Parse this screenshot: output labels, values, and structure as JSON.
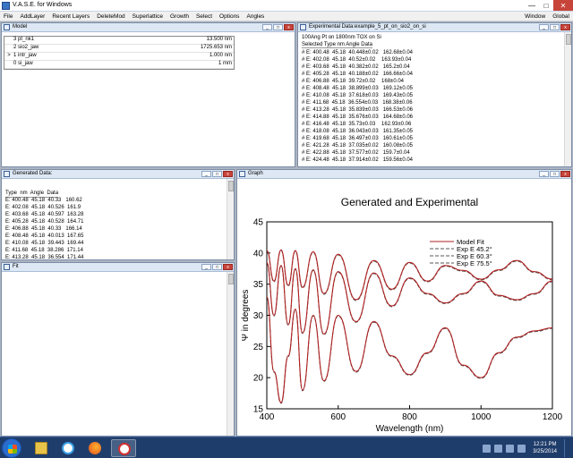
{
  "app": {
    "title": "V.A.S.E. for Windows"
  },
  "window_controls": {
    "minimize": "—",
    "maximize": "□",
    "close": "✕"
  },
  "menu": {
    "items": [
      "File",
      "AddLayer",
      "Recent Layers",
      "DeleteMod",
      "Superlattice",
      "Growth",
      "Select",
      "Options",
      "Angles"
    ],
    "right_items": [
      "Window",
      "Global"
    ]
  },
  "model_pane": {
    "title": "Model",
    "rows": [
      {
        "mark": "",
        "layer": "3 pt_nk1",
        "thickness": "13.500 nm"
      },
      {
        "mark": "",
        "layer": "2 sio2_jaw",
        "thickness": "1725.653 nm"
      },
      {
        "mark": ">",
        "layer": "1 intr_jaw",
        "thickness": "1.000 nm"
      },
      {
        "mark": "",
        "layer": "0 si_jaw",
        "thickness": "1 mm"
      }
    ]
  },
  "exp_pane": {
    "title": "Experimental Data:example_5_pt_on_sio2_on_si",
    "subtitle": "100Ang Pt on 1800nm TOX on Si",
    "header": "Selected Type  nm  Angle  Data",
    "rows": [
      "# E: 400.48  45.18  40.448±0.02   162.68±0.04",
      "# E: 402.08  45.18  40.52±0.02    163.93±0.04",
      "# E: 403.68  45.18  40.382±0.02   165.2±0.04",
      "# E: 405.28  45.18  40.188±0.02   166.66±0.04",
      "# E: 406.88  45.18  39.72±0.02    168±0.04",
      "# E: 408.48  45.18  38.899±0.03   169.12±0.05",
      "# E: 410.08  45.18  37.618±0.03   169.43±0.05",
      "# E: 411.68  45.18  36.554±0.03   168.38±0.06",
      "# E: 413.28  45.18  35.839±0.03   166.53±0.06",
      "# E: 414.88  45.18  35.676±0.03   164.68±0.06",
      "# E: 416.48  45.18  35.73±0.03    162.93±0.06",
      "# E: 418.08  45.18  36.043±0.03   161.35±0.05",
      "# E: 419.68  45.18  36.497±0.03   160.61±0.05",
      "# E: 421.28  45.18  37.035±0.02   160.08±0.05",
      "# E: 422.88  45.18  37.577±0.02   159.7±0.04",
      "# E: 424.48  45.18  37.914±0.02   159.56±0.04"
    ]
  },
  "gen_pane": {
    "title": "Generated Data:",
    "header": "Type  nm  Angle  Data",
    "rows": [
      "E: 400.48  45.18  40.33   160.62",
      "E: 402.08  45.18  40.526  161.9",
      "E: 403.68  45.18  40.597  163.28",
      "E: 405.28  45.18  40.528  164.71",
      "E: 406.88  45.18  40.33   166.14",
      "E: 408.48  45.18  40.013  167.65",
      "E: 410.08  45.18  39.443  169.44",
      "E: 411.68  45.18  38.286  171.14",
      "E: 413.28  45.18  36.554  171.44"
    ]
  },
  "fit_pane": {
    "title": "Fit"
  },
  "graph_pane": {
    "title": "Graph"
  },
  "chart_data": {
    "type": "line",
    "title": "Generated and Experimental",
    "xlabel": "Wavelength (nm)",
    "ylabel": "Ψ in degrees",
    "xlim": [
      400,
      1200
    ],
    "ylim": [
      15,
      45
    ],
    "xticks": [
      400,
      600,
      800,
      1000,
      1200
    ],
    "yticks": [
      15,
      20,
      25,
      30,
      35,
      40,
      45
    ],
    "grid": false,
    "legend_position": "top-right",
    "legend": [
      "Model Fit",
      "Exp E 45.2°",
      "Exp E 60.3°",
      "Exp E 75.5°"
    ],
    "series": [
      {
        "angle": 45.2,
        "x": [
          400,
          420,
          440,
          460,
          480,
          500,
          530,
          560,
          600,
          650,
          700,
          750,
          800,
          850,
          900,
          950,
          1000,
          1050,
          1100,
          1150,
          1200
        ],
        "y": [
          40.4,
          35.5,
          40.5,
          34.8,
          40.4,
          34.5,
          40.2,
          33.5,
          39.8,
          32.5,
          38.8,
          34.2,
          38.5,
          35.5,
          38.0,
          37.2,
          35.8,
          37.3,
          38.8,
          37.0,
          35.8
        ]
      },
      {
        "angle": 60.3,
        "x": [
          400,
          420,
          440,
          460,
          480,
          500,
          530,
          560,
          600,
          650,
          700,
          750,
          800,
          850,
          900,
          950,
          1000,
          1050,
          1100,
          1150,
          1200
        ],
        "y": [
          38.5,
          30.0,
          38.0,
          28.5,
          37.5,
          27.2,
          37.3,
          27.0,
          37.0,
          29.0,
          36.8,
          31.5,
          36.0,
          33.5,
          32.0,
          33.5,
          35.5,
          33.2,
          32.5,
          33.5,
          35.5
        ]
      },
      {
        "angle": 75.5,
        "x": [
          400,
          420,
          440,
          460,
          480,
          500,
          530,
          560,
          600,
          650,
          700,
          750,
          800,
          850,
          900,
          950,
          1000,
          1050,
          1100,
          1150,
          1200
        ],
        "y": [
          33.0,
          21.0,
          16.0,
          23.5,
          31.0,
          18.0,
          30.0,
          19.5,
          30.0,
          21.0,
          29.0,
          23.5,
          20.5,
          24.0,
          28.0,
          22.0,
          20.0,
          24.0,
          26.5,
          27.5,
          28.0
        ]
      }
    ],
    "colors": {
      "model": "#b02020",
      "exp": "#555555"
    }
  },
  "taskbar": {
    "apps": [
      "file-explorer",
      "internet-explorer",
      "firefox",
      "vase"
    ],
    "time": "12:21 PM",
    "date": "3/25/2014"
  }
}
